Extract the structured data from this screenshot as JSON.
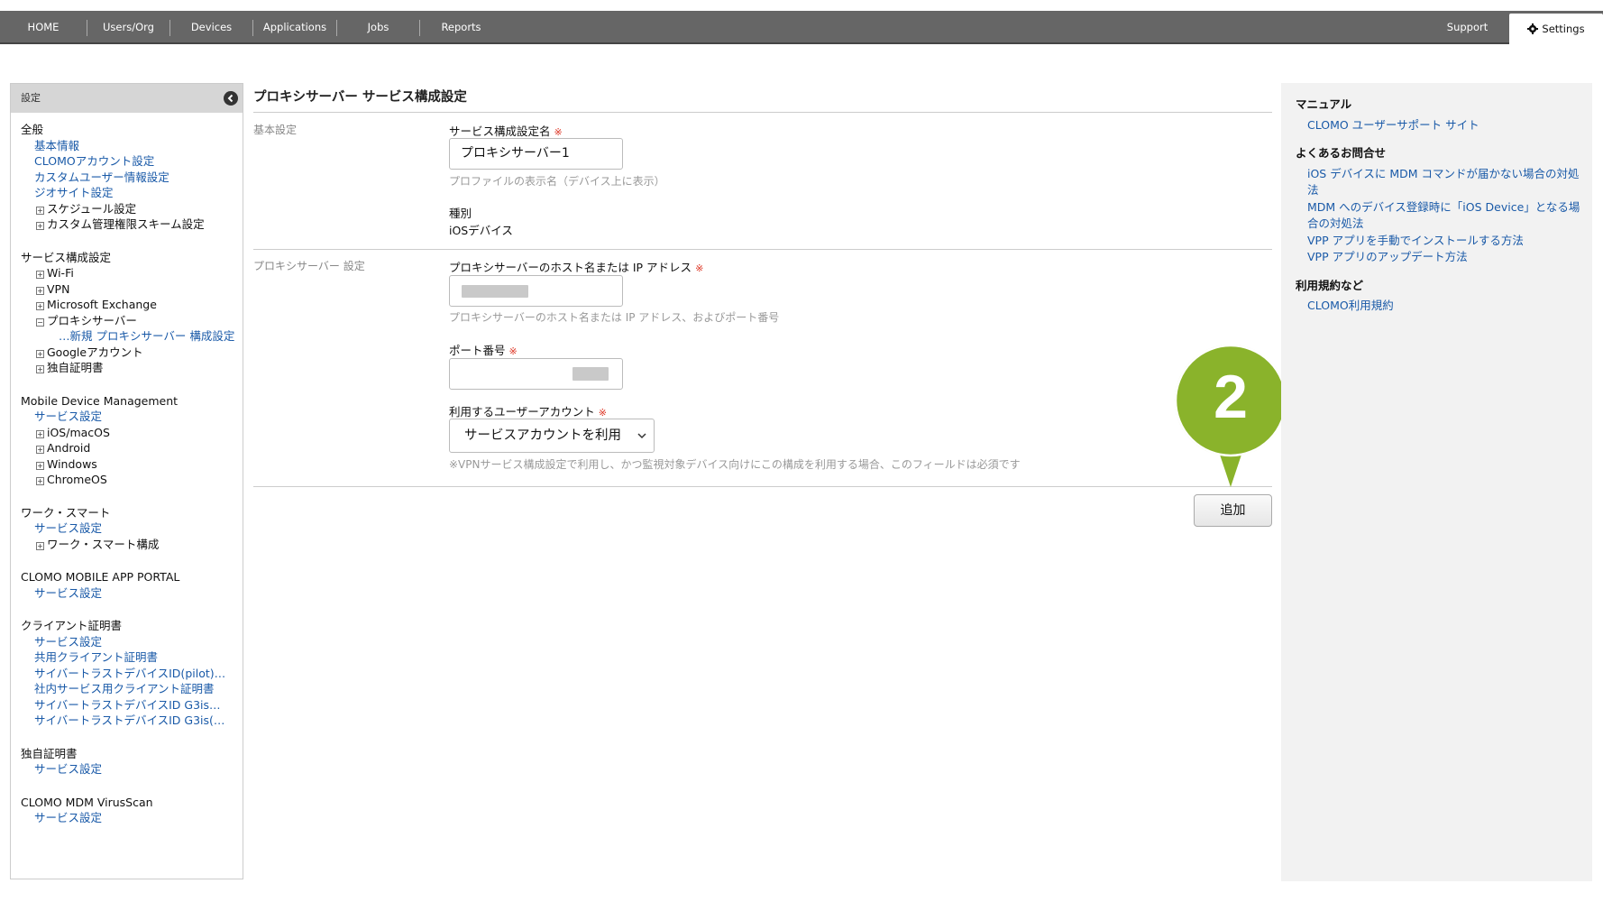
{
  "nav": {
    "items": [
      "HOME",
      "Users/Org",
      "Devices",
      "Applications",
      "Jobs",
      "Reports"
    ],
    "support": "Support",
    "settings": "Settings"
  },
  "sidebar": {
    "header": "設定",
    "general": {
      "title": "全般",
      "links": [
        "基本情報",
        "CLOMOアカウント設定",
        "カスタムユーザー情報設定",
        "ジオサイト設定"
      ],
      "tree": [
        "スケジュール設定",
        "カスタム管理権限スキーム設定"
      ]
    },
    "service": {
      "title": "サービス構成設定",
      "tree": [
        "Wi-Fi",
        "VPN",
        "Microsoft Exchange",
        "プロキシサーバー"
      ],
      "sub": "…新規 プロキシサーバー 構成設定",
      "tree2": [
        "Googleアカウント",
        "独自証明書"
      ]
    },
    "mdm": {
      "title": "Mobile Device Management",
      "link": "サービス設定",
      "tree": [
        "iOS/macOS",
        "Android",
        "Windows",
        "ChromeOS"
      ]
    },
    "work": {
      "title": "ワーク・スマート",
      "link": "サービス設定",
      "tree": [
        "ワーク・スマート構成"
      ]
    },
    "portal": {
      "title": "CLOMO MOBILE APP PORTAL",
      "link": "サービス設定"
    },
    "client_cert": {
      "title": "クライアント証明書",
      "links": [
        "サービス設定",
        "共用クライアント証明書",
        "サイバートラストデバイスID(pilot)…",
        "社内サービス用クライアント証明書",
        "サイバートラストデバイスID G3is…",
        "サイバートラストデバイスID G3is(…"
      ]
    },
    "own_cert": {
      "title": "独自証明書",
      "link": "サービス設定"
    },
    "virus": {
      "title": "CLOMO MDM VirusScan",
      "link": "サービス設定"
    }
  },
  "main": {
    "title": "プロキシサーバー サービス構成設定",
    "basic_section": "基本設定",
    "config_name_label": "サービス構成設定名",
    "config_name_value": "プロキシサーバー1",
    "config_name_hint": "プロファイルの表示名（デバイス上に表示）",
    "type_label": "種別",
    "type_value": "iOSデバイス",
    "proxy_section": "プロキシサーバー 設定",
    "host_label": "プロキシサーバーのホスト名または IP アドレス",
    "host_hint": "プロキシサーバーのホスト名または IP アドレス、およびポート番号",
    "port_label": "ポート番号",
    "account_label": "利用するユーザーアカウント",
    "account_value": "サービスアカウントを利用",
    "account_note": "※VPNサービス構成設定で利用し、かつ監視対象デバイス向けにこの構成を利用する場合、このフィールドは必須です",
    "required_mark": "※",
    "add_button": "追加",
    "callout_number": "2"
  },
  "right": {
    "manual_title": "マニュアル",
    "manual_links": [
      "CLOMO ユーザーサポート サイト"
    ],
    "faq_title": "よくあるお問合せ",
    "faq_links": [
      "iOS デバイスに MDM コマンドが届かない場合の対処法",
      "MDM へのデバイス登録時に「iOS Device」となる場合の対処法",
      "VPP アプリを手動でインストールする方法",
      "VPP アプリのアップデート方法"
    ],
    "terms_title": "利用規約など",
    "terms_links": [
      "CLOMO利用規約"
    ]
  },
  "colors": {
    "link": "#1a5aa8",
    "topbar": "#666666",
    "callout": "#8ab32b",
    "required": "#dd3322"
  }
}
